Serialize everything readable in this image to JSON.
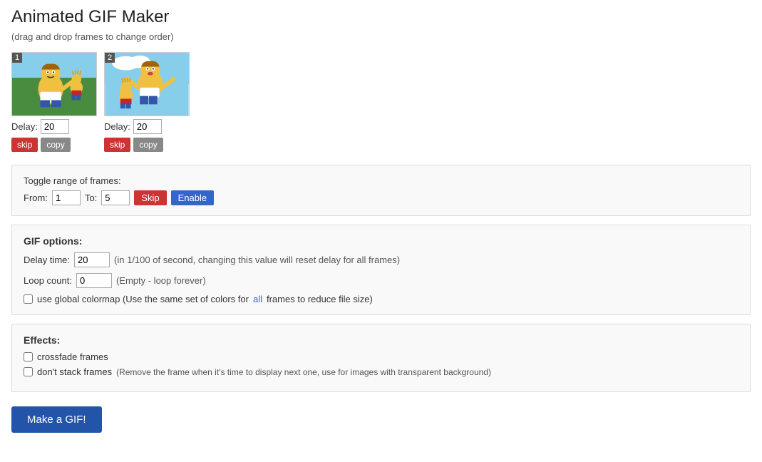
{
  "app": {
    "title": "Animated GIF Maker",
    "subtitle": "(drag and drop frames to change order)"
  },
  "frames": [
    {
      "id": 1,
      "badge": "1",
      "delay_label": "Delay:",
      "delay_value": "20",
      "skip_label": "skip",
      "copy_label": "copy"
    },
    {
      "id": 2,
      "badge": "2",
      "delay_label": "Delay:",
      "delay_value": "20",
      "skip_label": "skip",
      "copy_label": "copy"
    }
  ],
  "toggle_range": {
    "title": "Toggle range of frames:",
    "from_label": "From:",
    "from_value": "1",
    "to_label": "To:",
    "to_value": "5",
    "skip_label": "Skip",
    "enable_label": "Enable"
  },
  "gif_options": {
    "title": "GIF options:",
    "delay_label": "Delay time:",
    "delay_value": "20",
    "delay_note": "(in 1/100 of second, changing this value will reset delay for all frames)",
    "loop_label": "Loop count:",
    "loop_value": "0",
    "loop_note": "(Empty - loop forever)",
    "colormap_checkbox_label": "use global colormap (Use the same set of colors for ",
    "colormap_link_text": "all",
    "colormap_after": " frames to reduce file size)"
  },
  "effects": {
    "title": "Effects:",
    "crossfade_label": "crossfade frames",
    "dont_stack_label": "don't stack frames",
    "dont_stack_note": "(Remove the frame when it's time to display next one, use for images with transparent background)"
  },
  "make_gif_button": "Make a GIF!"
}
